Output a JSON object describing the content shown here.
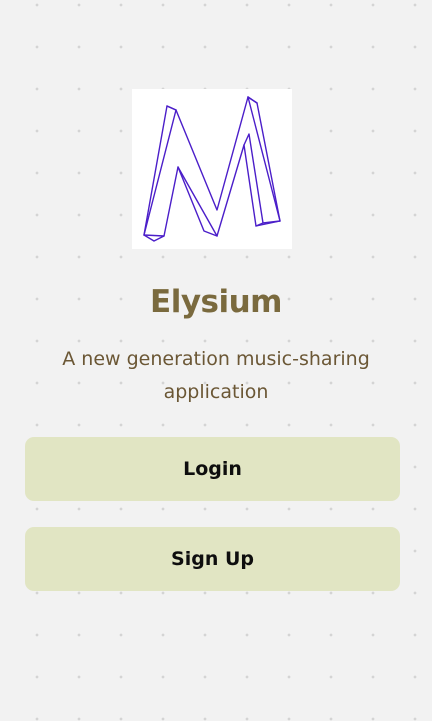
{
  "app": {
    "logo_icon": "m-letter-logo-icon",
    "title": "Elysium",
    "subtitle": "A new generation music-sharing application"
  },
  "actions": {
    "login_label": "Login",
    "signup_label": "Sign Up"
  },
  "colors": {
    "background": "#f2f2f2",
    "title": "#7a6a3e",
    "subtitle": "#6b5735",
    "button_bg": "#e1e5c3",
    "logo_stroke": "#4b1ec9"
  }
}
